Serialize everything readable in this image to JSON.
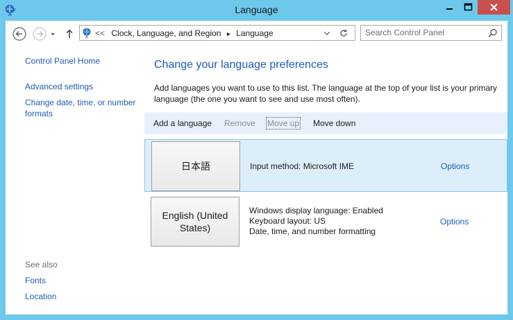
{
  "window": {
    "title": "Language"
  },
  "addressbar": {
    "crumb_sep": "<<",
    "crumb_parent": "Clock, Language, and Region",
    "crumb_current": "Language",
    "arrow": "▸"
  },
  "search": {
    "placeholder": "Search Control Panel"
  },
  "sidebar": {
    "home": "Control Panel Home",
    "advanced": "Advanced settings",
    "date_time_1": "Change date, time, or number",
    "date_time_2": "formats",
    "see_also": "See also",
    "fonts": "Fonts",
    "location": "Location"
  },
  "main": {
    "title": "Change your language preferences",
    "desc_1": "Add languages you want to use to this list. The language at the top of your list is your primary",
    "desc_2": "language (the one you want to see and use most often)."
  },
  "toolbar": {
    "add": "Add a language",
    "remove": "Remove",
    "move_up": "Move up",
    "move_down": "Move down"
  },
  "languages": [
    {
      "name_1": "日本語",
      "name_2": "",
      "details": [
        "Input method: Microsoft IME"
      ],
      "options": "Options"
    },
    {
      "name_1": "English (United",
      "name_2": "States)",
      "details": [
        "Windows display language: Enabled",
        "Keyboard layout: US",
        "Date, time, and number formatting"
      ],
      "options": "Options"
    }
  ],
  "colors": {
    "frame": "#6dc8ec",
    "link": "#1e5bb8",
    "selected_row": "#ddeefb",
    "close": "#c7504c"
  },
  "icons": [
    "control-panel-icon",
    "minimize-icon",
    "maximize-icon",
    "close-icon",
    "back-icon",
    "forward-icon",
    "recent-dropdown-icon",
    "up-icon",
    "location-icon",
    "address-dropdown-icon",
    "refresh-icon",
    "search-icon"
  ]
}
